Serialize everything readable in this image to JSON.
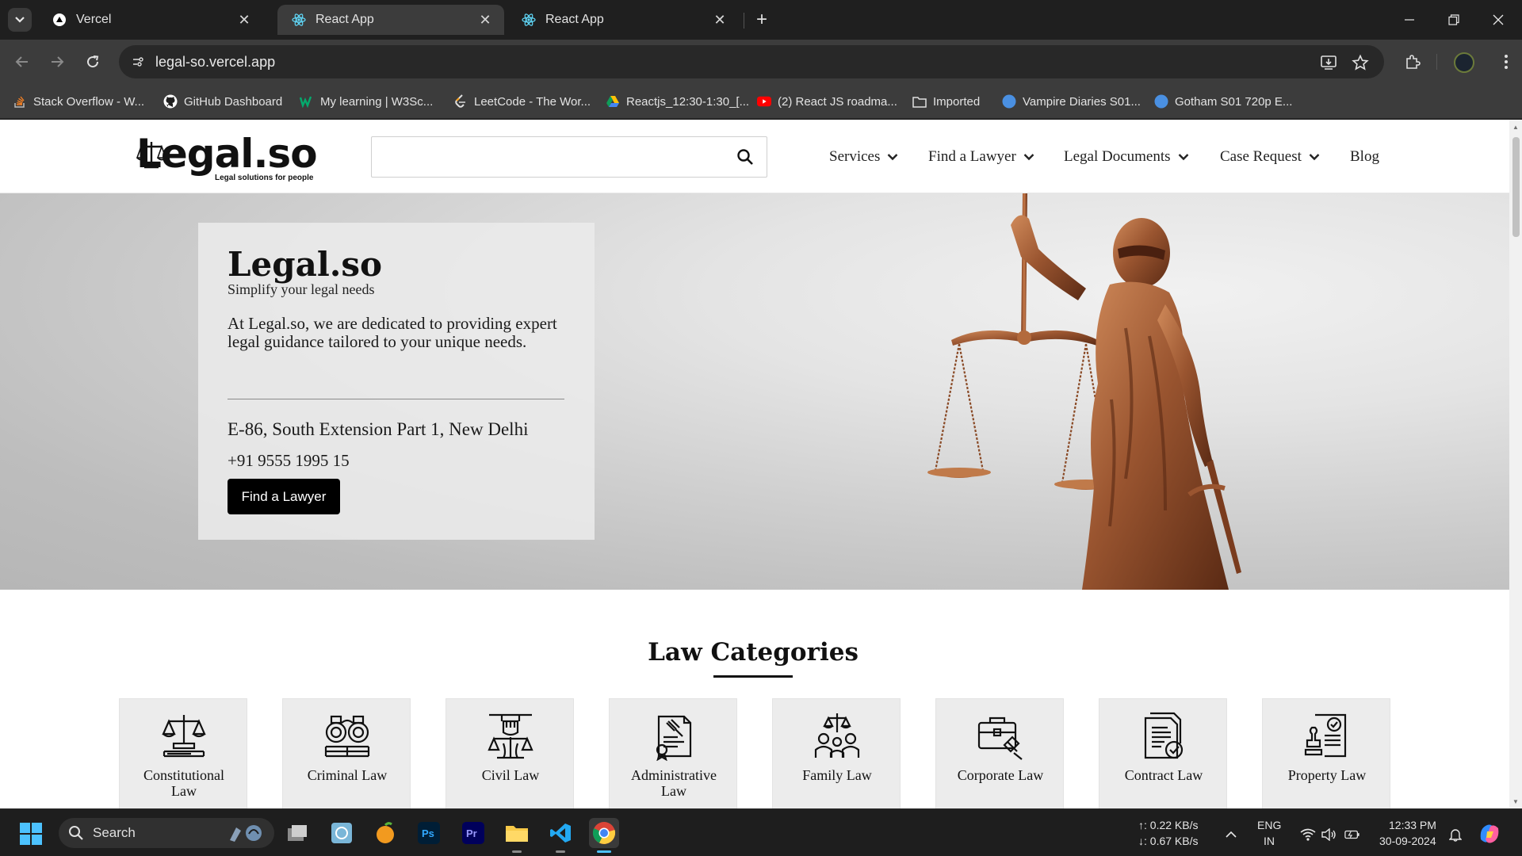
{
  "browser": {
    "tabs": [
      {
        "title": "Vercel",
        "active": false
      },
      {
        "title": "React App",
        "active": true
      },
      {
        "title": "React App",
        "active": false
      }
    ],
    "url": "legal-so.vercel.app",
    "bookmarks": [
      {
        "label": "Stack Overflow - W...",
        "icon": "stackoverflow-icon"
      },
      {
        "label": "GitHub Dashboard",
        "icon": "github-icon"
      },
      {
        "label": "My learning | W3Sc...",
        "icon": "w3schools-icon"
      },
      {
        "label": "LeetCode - The Wor...",
        "icon": "leetcode-icon"
      },
      {
        "label": "Reactjs_12:30-1:30_[...",
        "icon": "google-drive-icon"
      },
      {
        "label": "(2) React JS roadma...",
        "icon": "youtube-icon"
      },
      {
        "label": "Imported",
        "icon": "folder-icon"
      },
      {
        "label": "Vampire Diaries S01...",
        "icon": "globe-icon"
      },
      {
        "label": "Gotham S01 720p E...",
        "icon": "globe-icon"
      }
    ]
  },
  "site": {
    "logo": {
      "text": "Legal.so",
      "tagline": "Legal solutions for people"
    },
    "search": {
      "placeholder": "",
      "value": ""
    },
    "nav": [
      {
        "label": "Services",
        "has_dropdown": true
      },
      {
        "label": "Find a Lawyer",
        "has_dropdown": true
      },
      {
        "label": "Legal Documents",
        "has_dropdown": true
      },
      {
        "label": "Case Request",
        "has_dropdown": true
      },
      {
        "label": "Blog",
        "has_dropdown": false
      }
    ],
    "hero": {
      "title": "Legal.so",
      "subtitle": "Simplify your legal needs",
      "description": "At Legal.so, we are dedicated to providing expert legal guidance tailored to your unique needs.",
      "address": "E-86, South Extension Part 1, New Delhi",
      "phone": "+91 9555 1995 15",
      "cta": "Find a Lawyer"
    },
    "categories_title": "Law Categories",
    "categories": [
      {
        "line1": "Constitutional",
        "line2": "Law",
        "icon": "constitution-scales-icon"
      },
      {
        "line1": "Criminal Law",
        "line2": "",
        "icon": "handcuffs-icon"
      },
      {
        "line1": "Civil Law",
        "line2": "",
        "icon": "civil-rights-icon"
      },
      {
        "line1": "Administrative",
        "line2": "Law",
        "icon": "gavel-document-icon"
      },
      {
        "line1": "Family Law",
        "line2": "",
        "icon": "family-icon"
      },
      {
        "line1": "Corporate Law",
        "line2": "",
        "icon": "briefcase-gavel-icon"
      },
      {
        "line1": "Contract Law",
        "line2": "",
        "icon": "contract-check-icon"
      },
      {
        "line1": "Property Law",
        "line2": "",
        "icon": "property-stamp-icon"
      }
    ]
  },
  "taskbar": {
    "search_label": "Search",
    "net_up": "↑: 0.22 KB/s",
    "net_down": "↓: 0.67 KB/s",
    "lang": "ENG",
    "region": "IN",
    "time": "12:33 PM",
    "date": "30-09-2024"
  }
}
